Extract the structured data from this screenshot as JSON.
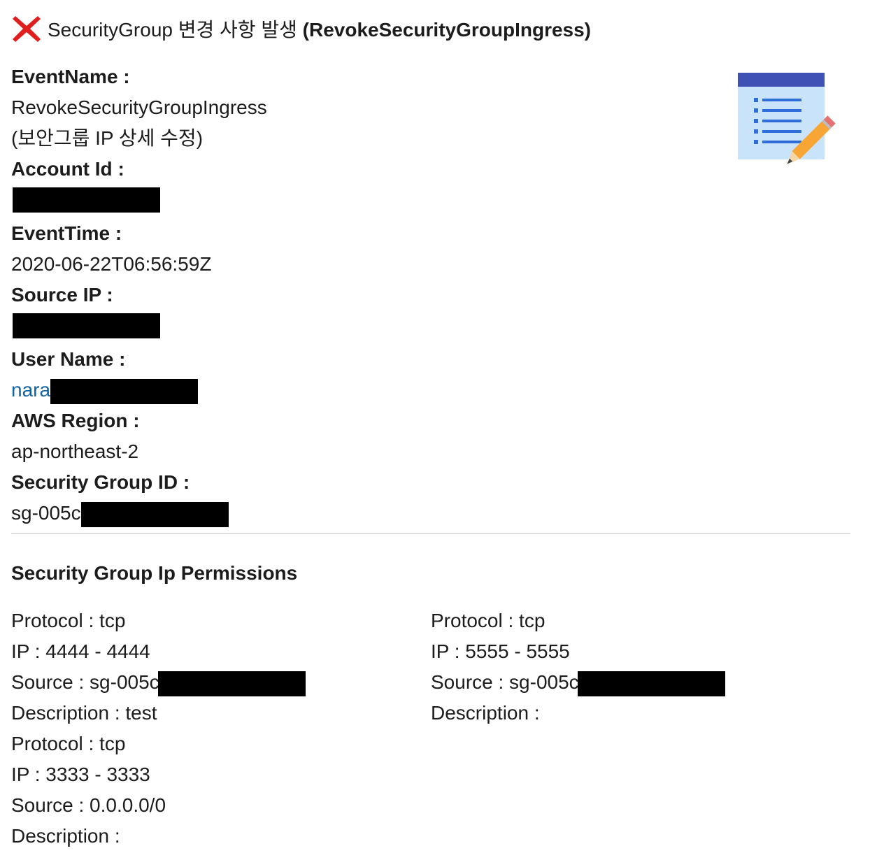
{
  "header": {
    "title_prefix": "SecurityGroup 변경 사항 발생 ",
    "title_bold": "(RevokeSecurityGroupIngress)",
    "status_icon": "x-icon",
    "status_color": "#e01e1e"
  },
  "fields": {
    "event_name_label": "EventName :",
    "event_name_value": "RevokeSecurityGroupIngress",
    "event_name_desc": "(보안그룹 IP 상세 수정)",
    "account_id_label": "Account Id :",
    "event_time_label": "EventTime :",
    "event_time_value": "2020-06-22T06:56:59Z",
    "source_ip_label": "Source IP :",
    "user_name_label": "User Name :",
    "user_name_value": "narac",
    "aws_region_label": "AWS Region :",
    "aws_region_value": "ap-northeast-2",
    "sg_id_label": "Security Group ID :",
    "sg_id_value": "sg-005cc"
  },
  "thumbnail_icon": "document-edit-icon",
  "permissions": {
    "title": "Security Group Ip Permissions",
    "left": [
      {
        "protocol": "Protocol : tcp",
        "ip": "IP : 4444 - 4444",
        "source": "Source : sg-005cc",
        "description": "Description : test"
      },
      {
        "protocol": "Protocol : tcp",
        "ip": "IP : 3333 - 3333",
        "source": "Source : 0.0.0.0/0",
        "description": "Description :"
      }
    ],
    "right": [
      {
        "protocol": "Protocol : tcp",
        "ip": "IP : 5555 - 5555",
        "source": "Source : sg-005cc",
        "description": "Description :"
      }
    ]
  }
}
